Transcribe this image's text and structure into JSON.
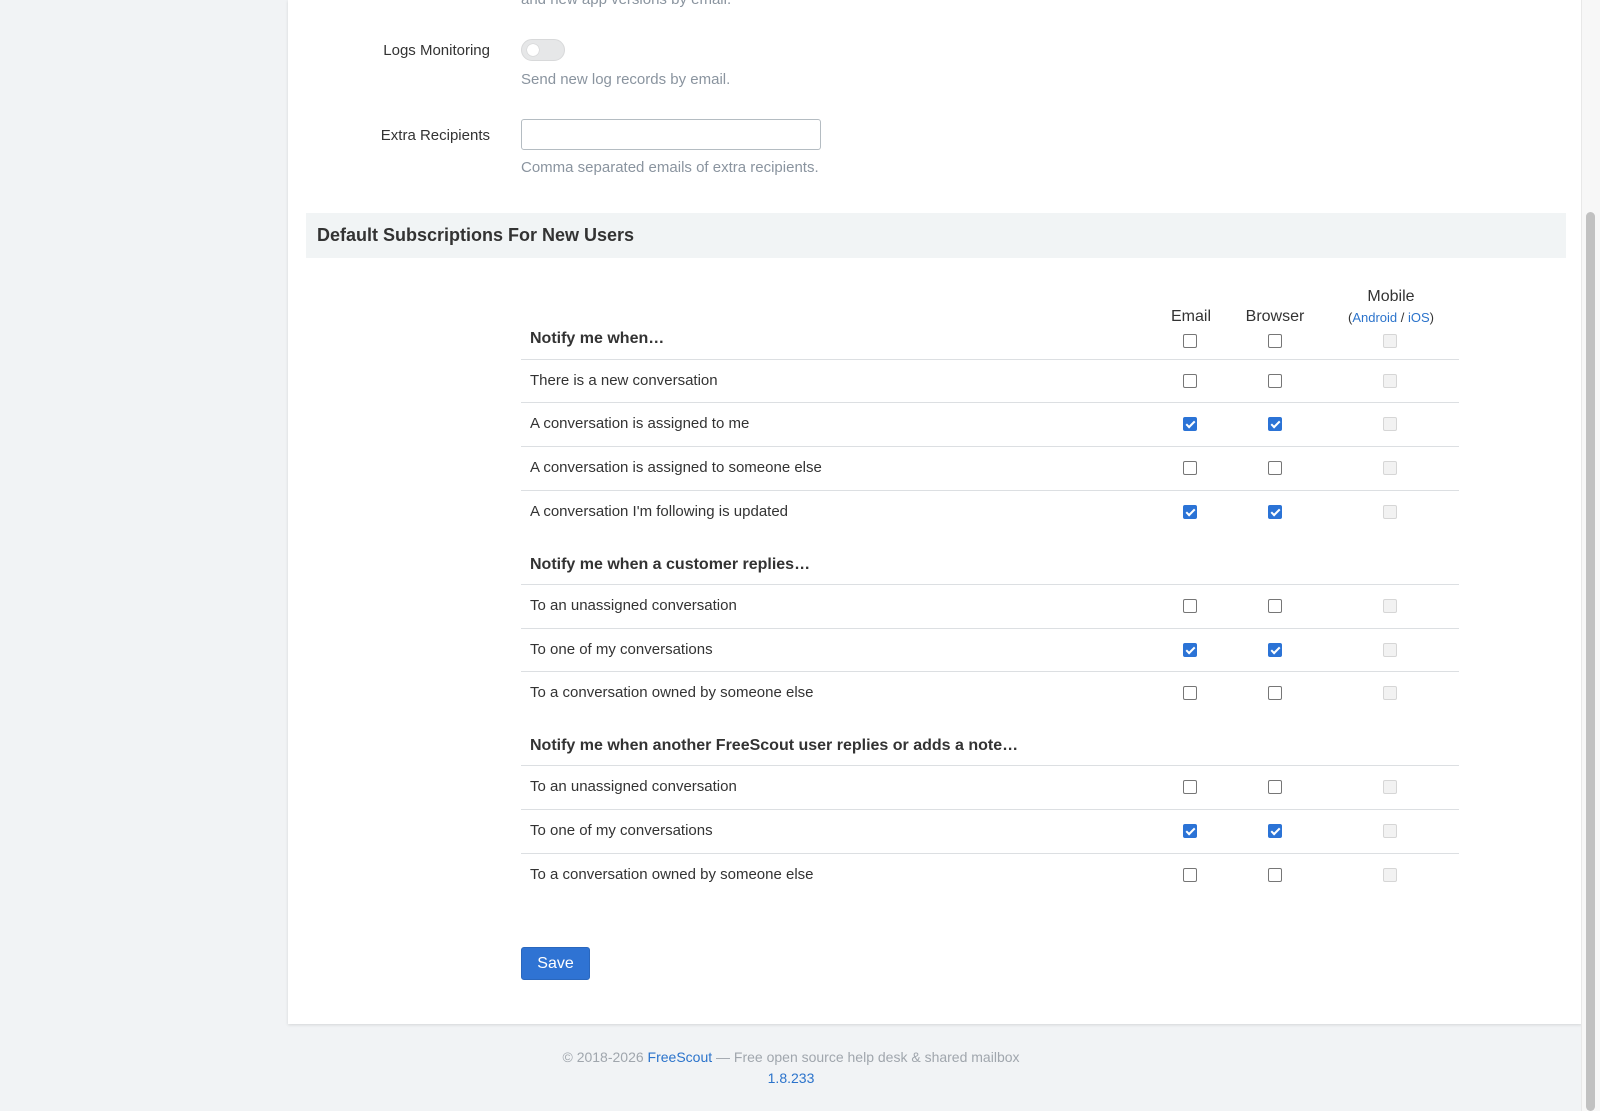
{
  "top": {
    "clipped_help_text": "and new app versions by email."
  },
  "logs_monitoring": {
    "label": "Logs Monitoring",
    "enabled": false,
    "help": "Send new log records by email."
  },
  "extra_recipients": {
    "label": "Extra Recipients",
    "value": "",
    "placeholder": "",
    "help": "Comma separated emails of extra recipients."
  },
  "section": {
    "title": "Default Subscriptions For New Users"
  },
  "columns": {
    "email": "Email",
    "browser": "Browser",
    "mobile": "Mobile",
    "mobile_open": "(",
    "android": "Android",
    "slash": " / ",
    "ios": "iOS",
    "mobile_close": ")"
  },
  "groups": [
    {
      "title": "Notify me when…",
      "all": {
        "email": false,
        "browser": false,
        "mobile": false
      },
      "rows": [
        {
          "label": "There is a new conversation",
          "email": false,
          "browser": false,
          "mobile": false
        },
        {
          "label": "A conversation is assigned to me",
          "email": true,
          "browser": true,
          "mobile": false
        },
        {
          "label": "A conversation is assigned to someone else",
          "email": false,
          "browser": false,
          "mobile": false
        },
        {
          "label": "A conversation I'm following is updated",
          "email": true,
          "browser": true,
          "mobile": false
        }
      ]
    },
    {
      "title": "Notify me when a customer replies…",
      "rows": [
        {
          "label": "To an unassigned conversation",
          "email": false,
          "browser": false,
          "mobile": false
        },
        {
          "label": "To one of my conversations",
          "email": true,
          "browser": true,
          "mobile": false
        },
        {
          "label": "To a conversation owned by someone else",
          "email": false,
          "browser": false,
          "mobile": false
        }
      ]
    },
    {
      "title": "Notify me when another FreeScout user replies or adds a note…",
      "rows": [
        {
          "label": "To an unassigned conversation",
          "email": false,
          "browser": false,
          "mobile": false
        },
        {
          "label": "To one of my conversations",
          "email": true,
          "browser": true,
          "mobile": false
        },
        {
          "label": "To a conversation owned by someone else",
          "email": false,
          "browser": false,
          "mobile": false
        }
      ]
    }
  ],
  "save_label": "Save",
  "footer": {
    "copyright": "© 2018-2026 ",
    "brand": "FreeScout",
    "tagline": " — Free open source help desk & shared mailbox",
    "version": "1.8.233"
  },
  "colors": {
    "accent": "#2b73d6",
    "link": "#2b73cb",
    "section_bg": "#f1f4f5"
  }
}
